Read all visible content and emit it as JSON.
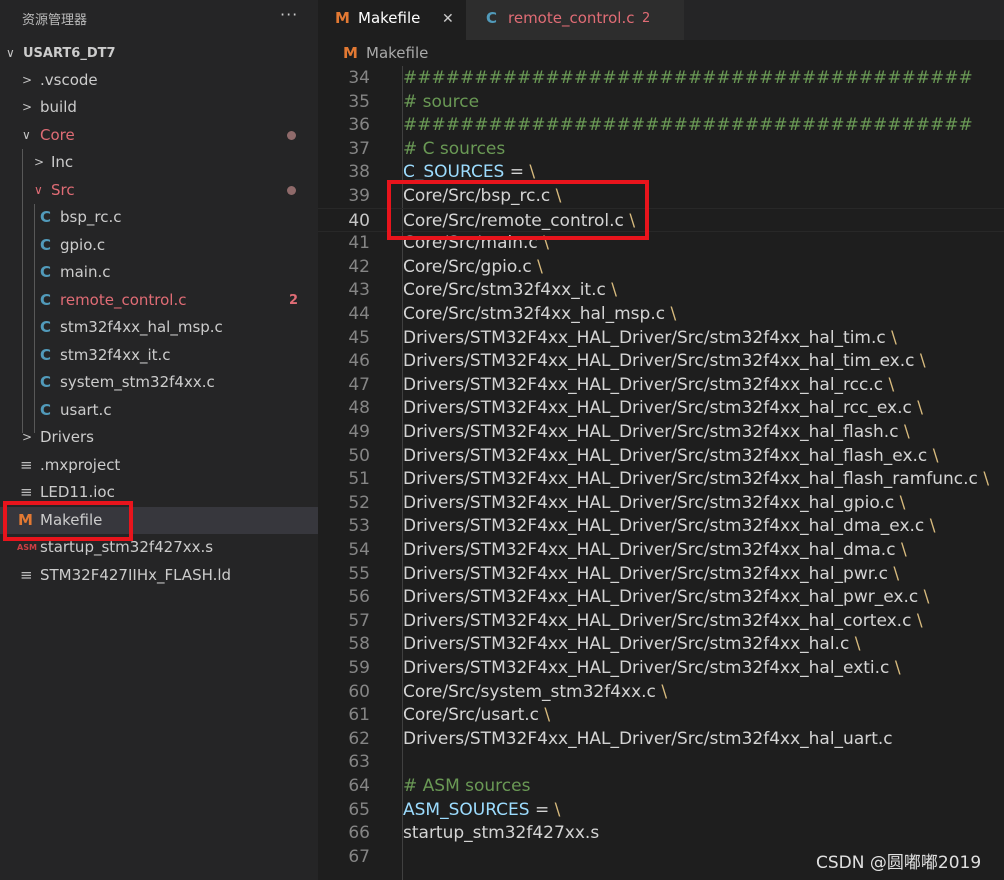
{
  "sidebar": {
    "title": "资源管理器",
    "more_label": "···",
    "root": "USART6_DT7",
    "folders": {
      "vscode": ".vscode",
      "build": "build",
      "core": "Core",
      "inc": "Inc",
      "src": "Src",
      "drivers": "Drivers"
    },
    "src_files": [
      "bsp_rc.c",
      "gpio.c",
      "main.c",
      "remote_control.c",
      "stm32f4xx_hal_msp.c",
      "stm32f4xx_it.c",
      "system_stm32f4xx.c",
      "usart.c"
    ],
    "remote_badge": "2",
    "root_files": {
      "mxproject": ".mxproject",
      "ioc": "LED11.ioc",
      "makefile": "Makefile",
      "startup": "startup_stm32f427xx.s",
      "ld": "STM32F427IIHx_FLASH.ld"
    },
    "asm_label": "ASM",
    "makefile_icon": "M",
    "c_icon": "C",
    "lines_icon": "≡"
  },
  "tabs": {
    "makefile": "Makefile",
    "remote": "remote_control.c",
    "remote_badge": "2",
    "close": "✕"
  },
  "breadcrumb": "Makefile",
  "code": {
    "line_numbers": [
      "34",
      "35",
      "36",
      "37",
      "38",
      "39",
      "40",
      "41",
      "42",
      "43",
      "44",
      "45",
      "46",
      "47",
      "48",
      "49",
      "50",
      "51",
      "52",
      "53",
      "54",
      "55",
      "56",
      "57",
      "58",
      "59",
      "60",
      "61",
      "62",
      "63",
      "64",
      "65",
      "66",
      "67"
    ],
    "hash_rule": "########################################",
    "source_comment": "# source",
    "c_sources_comment": "# C sources",
    "c_sources_var": "C_SOURCES",
    "assign": " = ",
    "backslash": "\\",
    "files": [
      "Core/Src/bsp_rc.c",
      "Core/Src/remote_control.c",
      "Core/Src/main.c",
      "Core/Src/gpio.c",
      "Core/Src/stm32f4xx_it.c",
      "Core/Src/stm32f4xx_hal_msp.c",
      "Drivers/STM32F4xx_HAL_Driver/Src/stm32f4xx_hal_tim.c",
      "Drivers/STM32F4xx_HAL_Driver/Src/stm32f4xx_hal_tim_ex.c",
      "Drivers/STM32F4xx_HAL_Driver/Src/stm32f4xx_hal_rcc.c",
      "Drivers/STM32F4xx_HAL_Driver/Src/stm32f4xx_hal_rcc_ex.c",
      "Drivers/STM32F4xx_HAL_Driver/Src/stm32f4xx_hal_flash.c",
      "Drivers/STM32F4xx_HAL_Driver/Src/stm32f4xx_hal_flash_ex.c",
      "Drivers/STM32F4xx_HAL_Driver/Src/stm32f4xx_hal_flash_ramfunc.c",
      "Drivers/STM32F4xx_HAL_Driver/Src/stm32f4xx_hal_gpio.c",
      "Drivers/STM32F4xx_HAL_Driver/Src/stm32f4xx_hal_dma_ex.c",
      "Drivers/STM32F4xx_HAL_Driver/Src/stm32f4xx_hal_dma.c",
      "Drivers/STM32F4xx_HAL_Driver/Src/stm32f4xx_hal_pwr.c",
      "Drivers/STM32F4xx_HAL_Driver/Src/stm32f4xx_hal_pwr_ex.c",
      "Drivers/STM32F4xx_HAL_Driver/Src/stm32f4xx_hal_cortex.c",
      "Drivers/STM32F4xx_HAL_Driver/Src/stm32f4xx_hal.c",
      "Drivers/STM32F4xx_HAL_Driver/Src/stm32f4xx_hal_exti.c",
      "Core/Src/system_stm32f4xx.c",
      "Core/Src/usart.c",
      "Drivers/STM32F4xx_HAL_Driver/Src/stm32f4xx_hal_uart.c"
    ],
    "asm_comment": "# ASM sources",
    "asm_var": "ASM_SOURCES",
    "asm_file": "startup_stm32f427xx.s"
  },
  "watermark": "CSDN @圆嘟嘟2019",
  "colors": {
    "highlight_box": "#e8141c",
    "comment": "#6a9955",
    "variable": "#9cdcfe",
    "modified_file": "#e06c75"
  }
}
